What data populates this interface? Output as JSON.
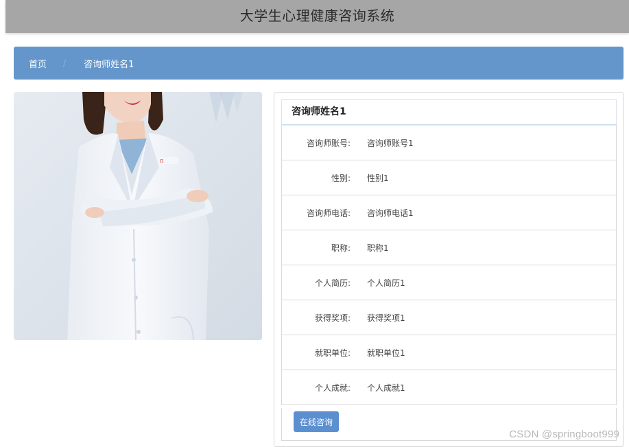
{
  "header": {
    "title": "大学生心理健康咨询系统"
  },
  "breadcrumb": {
    "items": [
      "首页",
      "咨询师姓名1"
    ],
    "separator": "/"
  },
  "detail": {
    "title": "咨询师姓名1",
    "fields": [
      {
        "label": "咨询师账号:",
        "value": "咨询师账号1"
      },
      {
        "label": "性别:",
        "value": "性别1"
      },
      {
        "label": "咨询师电话:",
        "value": "咨询师电话1"
      },
      {
        "label": "职称:",
        "value": "职称1"
      },
      {
        "label": "个人简历:",
        "value": "个人简历1"
      },
      {
        "label": "获得奖项:",
        "value": "获得奖项1"
      },
      {
        "label": "就职单位:",
        "value": "就职单位1"
      },
      {
        "label": "个人成就:",
        "value": "个人成就1"
      }
    ],
    "consult_button": "在线咨询"
  },
  "watermark": "CSDN @springboot999",
  "colors": {
    "header_bg": "#a6a6a6",
    "breadcrumb_bg": "#6496cc",
    "button_bg": "#5b8fd0"
  }
}
